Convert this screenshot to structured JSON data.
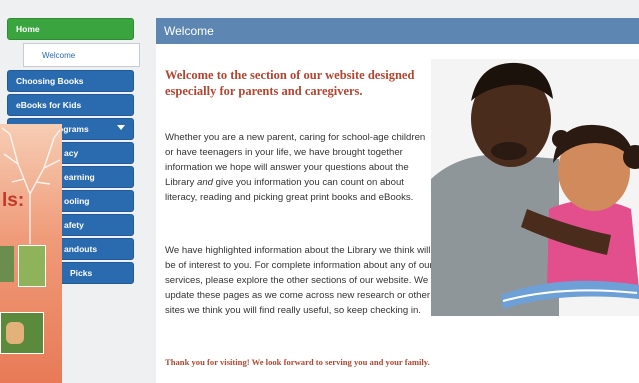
{
  "sidebar": {
    "items": [
      {
        "label": "Home",
        "style": "green"
      },
      {
        "label": "Welcome",
        "style": "sub"
      },
      {
        "label": "Choosing Books",
        "style": "blue"
      },
      {
        "label": "eBooks for Kids",
        "style": "blue"
      },
      {
        "label": "ograms",
        "style": "blue",
        "has_chevron": true
      },
      {
        "label": "acy",
        "style": "blue"
      },
      {
        "label": "earning",
        "style": "blue"
      },
      {
        "label": "ooling",
        "style": "blue"
      },
      {
        "label": "afety",
        "style": "blue"
      },
      {
        "label": "andouts",
        "style": "blue"
      },
      {
        "label": "Picks",
        "style": "blue"
      }
    ]
  },
  "brochure": {
    "title": "ls:"
  },
  "main": {
    "header": "Welcome",
    "intro_title": "Welcome to the section of our website designed especially for parents and caregivers.",
    "para1_before": "Whether you are a new parent, caring for school-age children or have teenagers in your life, we have brought together information we hope will answer your questions about the Library ",
    "para1_em": "and",
    "para1_after": " give you information you can count on about literacy, reading and picking great print books and eBooks.",
    "para2": "We have highlighted information about the Library we think will be of interest to you. For complete information about any of our services, please explore the other sections of our website. We update these pages as we come across new research or other sites we think you will find really useful, so keep checking in.",
    "thanks": "Thank you for visiting! We look forward to serving you and your family."
  },
  "colors": {
    "nav_blue": "#2a6bb0",
    "nav_green": "#3aa53f",
    "header_blue": "#5e86b3",
    "accent_red": "#b24530"
  }
}
